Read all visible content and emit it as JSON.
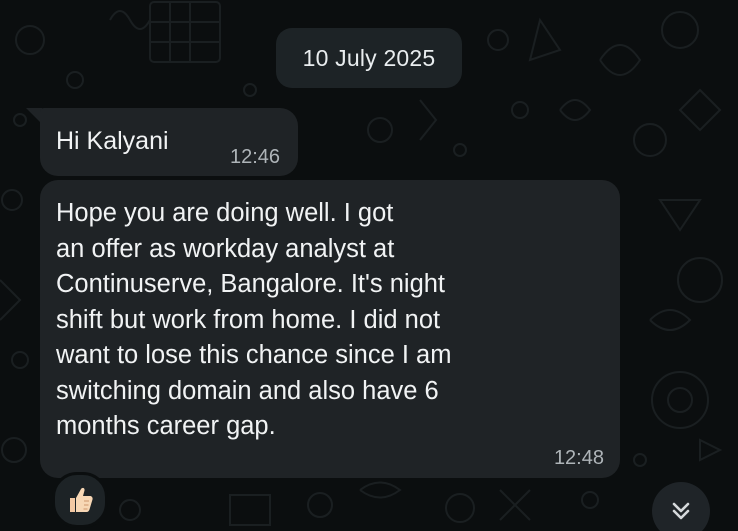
{
  "date_chip": "10 July 2025",
  "messages": [
    {
      "text": "Hi Kalyani",
      "time": "12:46"
    },
    {
      "text": "Hope you are doing well. I got\nan offer as workday analyst at\nContinuserve, Bangalore. It's night\nshift but work from home. I did not\nwant to lose this chance since I am\nswitching domain and also have 6\nmonths career gap.",
      "time": "12:48"
    }
  ],
  "reaction": {
    "icon": "thumbs-up-icon"
  },
  "scroll_button": {
    "icon": "double-chevron-down-icon"
  },
  "colors": {
    "background": "#0b0e0f",
    "bubble": "#1f2326",
    "text": "#f1f3f4",
    "timestamp": "#aeb4b8"
  }
}
